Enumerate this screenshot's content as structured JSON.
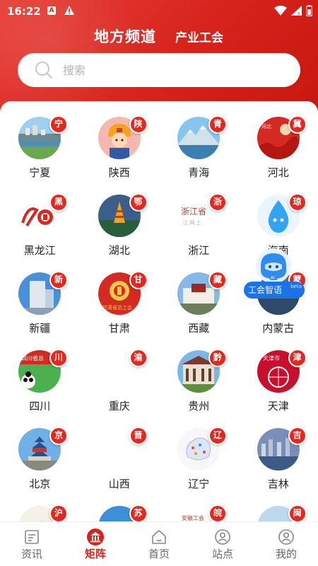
{
  "status": {
    "time": "16:22"
  },
  "header": {
    "title": "地方频道",
    "subtitle": "产业工会"
  },
  "search": {
    "placeholder": "搜索"
  },
  "accent_color": "#d6231c",
  "regions": [
    {
      "name": "宁夏",
      "badge": "宁",
      "icon": "lake-city-photo"
    },
    {
      "name": "陕西",
      "badge": "陕",
      "icon": "worker-mascot"
    },
    {
      "name": "青海",
      "badge": "青",
      "icon": "snow-mountain-photo"
    },
    {
      "name": "河北",
      "badge": "冀",
      "icon": "great-wall-poster"
    },
    {
      "name": "黑龙江",
      "badge": "黑",
      "icon": "union-logo-calligraphy"
    },
    {
      "name": "湖北",
      "badge": "鄂",
      "icon": "yellow-crane-tower"
    },
    {
      "name": "浙江",
      "badge": "浙",
      "icon": "zhejiang-online-text"
    },
    {
      "name": "海南",
      "badge": "琼",
      "icon": "blue-droplet-mascot"
    },
    {
      "name": "新疆",
      "badge": "新",
      "icon": "highrise-building"
    },
    {
      "name": "甘肃",
      "badge": "甘",
      "icon": "union-red-logo"
    },
    {
      "name": "西藏",
      "badge": "藏",
      "icon": "potala-palace"
    },
    {
      "name": "内蒙古",
      "badge": "蒙",
      "icon": "city-bridge"
    },
    {
      "name": "四川",
      "badge": "川",
      "icon": "panda-poster"
    },
    {
      "name": "重庆",
      "badge": "渝",
      "icon": "blank"
    },
    {
      "name": "贵州",
      "badge": "黔",
      "icon": "historic-building"
    },
    {
      "name": "天津",
      "badge": "津",
      "icon": "tianjin-ferris-wheel"
    },
    {
      "name": "北京",
      "badge": "京",
      "icon": "temple-of-heaven"
    },
    {
      "name": "山西",
      "badge": "晋",
      "icon": "blank"
    },
    {
      "name": "辽宁",
      "badge": "辽",
      "icon": "province-map"
    },
    {
      "name": "吉林",
      "badge": "吉",
      "icon": "river-city-skyline"
    },
    {
      "name": "",
      "badge": "沪",
      "icon": "calligraphy"
    },
    {
      "name": "",
      "badge": "苏",
      "icon": "blue-scene"
    },
    {
      "name": "",
      "badge": "皖",
      "icon": "anhui-union-text"
    },
    {
      "name": "",
      "badge": "闽",
      "icon": "fujian-scene"
    }
  ],
  "ai_assistant": {
    "label": "工会智语",
    "tag": "AI",
    "beta": "beta"
  },
  "tabs": [
    {
      "label": "资讯",
      "icon": "news-icon",
      "active": false
    },
    {
      "label": "矩阵",
      "icon": "matrix-building-icon",
      "active": true
    },
    {
      "label": "首页",
      "icon": "home-icon",
      "active": false
    },
    {
      "label": "站点",
      "icon": "site-user-icon",
      "active": false
    },
    {
      "label": "我的",
      "icon": "profile-icon",
      "active": false
    }
  ]
}
